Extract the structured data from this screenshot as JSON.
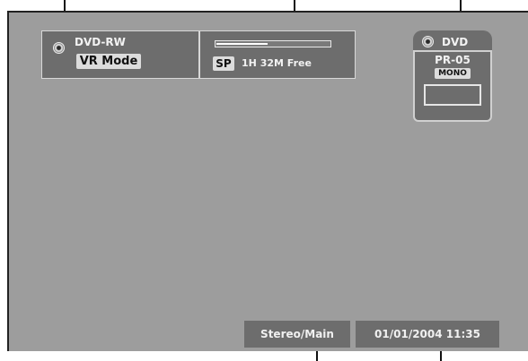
{
  "screen": {
    "disc_panel": {
      "icon": "disc-icon",
      "disc_type": "DVD-RW",
      "mode": "VR Mode"
    },
    "record_panel": {
      "quality": "SP",
      "time_free": "1H 32M Free",
      "used_fraction": 0.45
    },
    "source_panel": {
      "icon": "disc-icon",
      "label": "DVD",
      "channel": "PR-05",
      "audio": "MONO"
    },
    "audio_status": "Stereo/Main",
    "datetime": "01/01/2004 11:35"
  },
  "colors": {
    "panel": "#6d6d6d",
    "screen": "#9d9d9d",
    "border": "#d8d8d8"
  }
}
